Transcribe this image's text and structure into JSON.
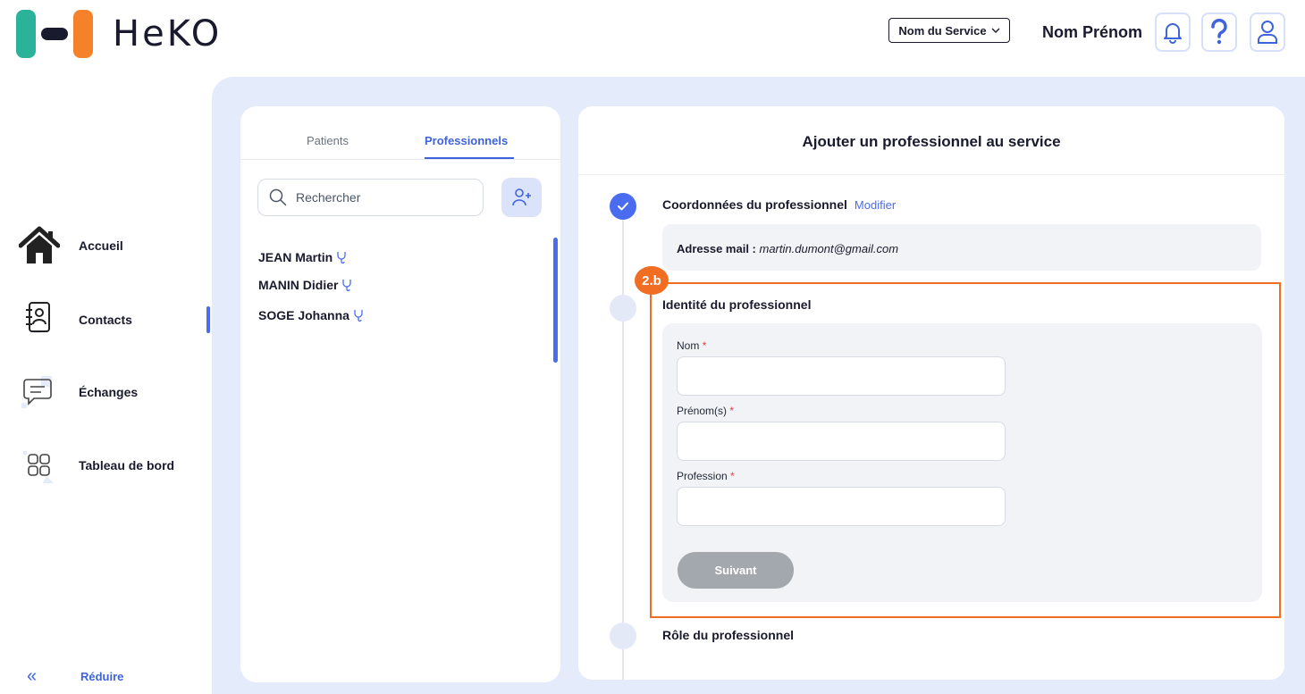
{
  "header": {
    "brand": "HeKO",
    "service_select": "Nom du Service",
    "user_name": "Nom Prénom",
    "icons": [
      "bell-icon",
      "help-icon",
      "user-icon"
    ]
  },
  "sidebar": {
    "items": [
      {
        "label": "Accueil",
        "icon": "home-icon"
      },
      {
        "label": "Contacts",
        "icon": "contacts-icon",
        "active": true
      },
      {
        "label": "Échanges",
        "icon": "chat-icon"
      },
      {
        "label": "Tableau de bord",
        "icon": "dashboard-icon"
      }
    ],
    "reduce_label": "Réduire"
  },
  "contacts_panel": {
    "tabs": [
      {
        "label": "Patients"
      },
      {
        "label": "Professionnels",
        "active": true
      }
    ],
    "search_placeholder": "Rechercher",
    "contacts": [
      {
        "name": "JEAN Martin"
      },
      {
        "name": "MANIN Didier"
      },
      {
        "name": "SOGE Johanna"
      }
    ]
  },
  "form_panel": {
    "title": "Ajouter un professionnel au service",
    "step1": {
      "title": "Coordonnées du professionnel",
      "modify": "Modifier",
      "mail_label": "Adresse mail :",
      "mail_value": "martin.dumont@gmail.com"
    },
    "step2": {
      "badge": "2.b",
      "title": "Identité du professionnel",
      "fields": [
        {
          "label": "Nom",
          "required": "*"
        },
        {
          "label": "Prénom(s)",
          "required": "*"
        },
        {
          "label": "Profession",
          "required": "*"
        }
      ],
      "next_button": "Suivant"
    },
    "step3": {
      "title": "Rôle du professionnel"
    }
  },
  "colors": {
    "accent": "#3e63dd",
    "highlight": "#f06d22",
    "brand_green": "#2bb39a",
    "brand_orange": "#f5822a",
    "main_bg": "#e4ebfa"
  }
}
